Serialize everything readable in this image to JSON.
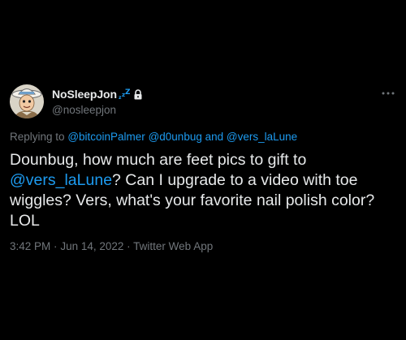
{
  "user": {
    "display_name": "NoSleepJon",
    "handle": "@nosleepjon"
  },
  "icons": {
    "avatar": "avatar-cartoon-cowboy",
    "name_badge": "zzz-sleep-icon",
    "protected": "lock-icon",
    "more": "more-icon"
  },
  "replying": {
    "prefix": "Replying to",
    "mention_1": "@bitcoinPalmer",
    "mention_2": "@d0unbug",
    "conjunction": "and",
    "mention_3": "@vers_laLune"
  },
  "tweet": {
    "text_1": "Dounbug, how much are feet pics to gift to ",
    "mention": "@vers_laLune",
    "text_2": "? Can I upgrade to a video with toe wiggles? Vers, what's your favorite nail polish color? LOL"
  },
  "meta": {
    "time": "3:42 PM",
    "date": "Jun 14, 2022",
    "source": "Twitter Web App",
    "separator": "·"
  },
  "colors": {
    "background": "#000000",
    "text": "#e7e9ea",
    "secondary": "#71767b",
    "link": "#1d9bf0"
  }
}
